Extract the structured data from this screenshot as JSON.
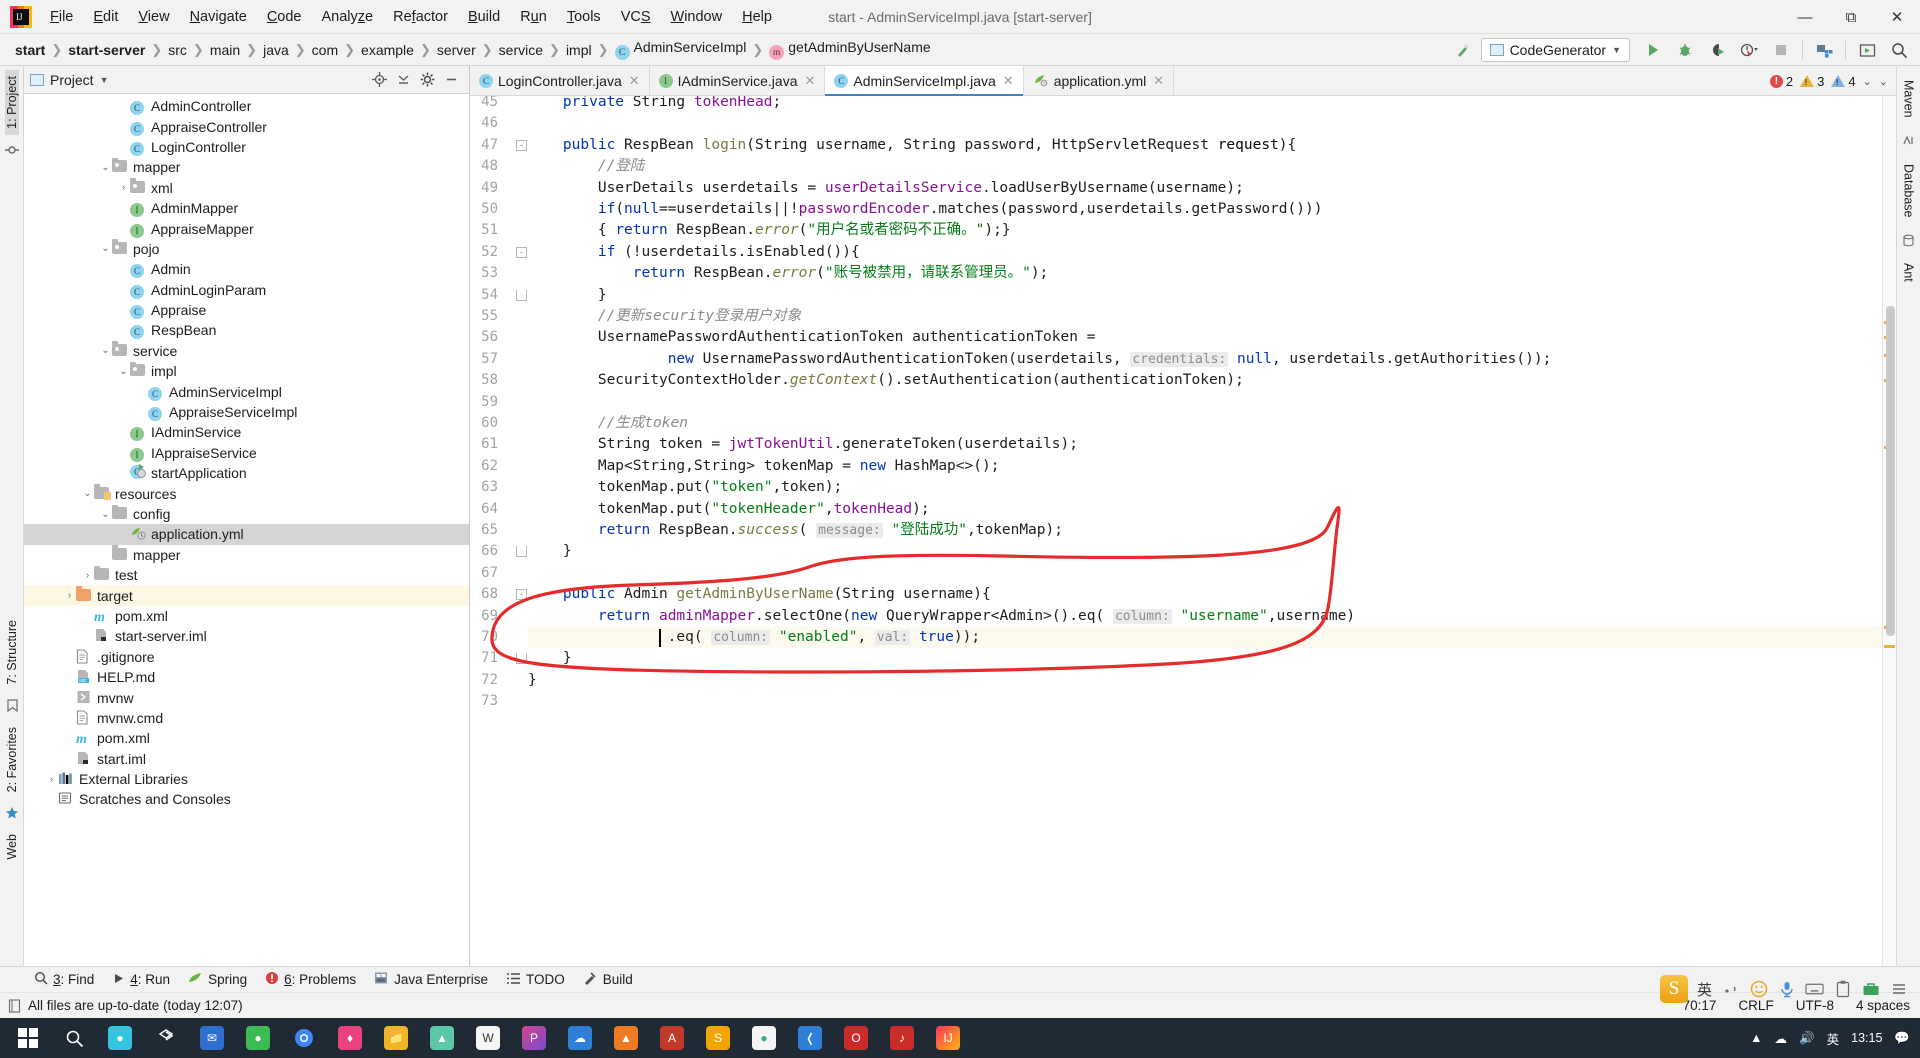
{
  "window": {
    "title": "start - AdminServiceImpl.java [start-server]",
    "menu": [
      "File",
      "Edit",
      "View",
      "Navigate",
      "Code",
      "Analyze",
      "Refactor",
      "Build",
      "Run",
      "Tools",
      "VCS",
      "Window",
      "Help"
    ],
    "controls": {
      "minimize": "—",
      "maximize": "❐",
      "close": "✕"
    }
  },
  "breadcrumbs": [
    {
      "label": "start",
      "bold": true,
      "icon": null
    },
    {
      "label": "start-server",
      "bold": true,
      "icon": null
    },
    {
      "label": "src",
      "bold": false,
      "icon": null
    },
    {
      "label": "main",
      "bold": false,
      "icon": null
    },
    {
      "label": "java",
      "bold": false,
      "icon": null
    },
    {
      "label": "com",
      "bold": false,
      "icon": null
    },
    {
      "label": "example",
      "bold": false,
      "icon": null
    },
    {
      "label": "server",
      "bold": false,
      "icon": null
    },
    {
      "label": "service",
      "bold": false,
      "icon": null
    },
    {
      "label": "impl",
      "bold": false,
      "icon": null
    },
    {
      "label": "AdminServiceImpl",
      "bold": false,
      "icon": "class"
    },
    {
      "label": "getAdminByUserName",
      "bold": false,
      "icon": "method"
    }
  ],
  "toolbar": {
    "run_config": "CodeGenerator",
    "run_config_caret": "▼",
    "icons": [
      "build-hammer-icon",
      "run-icon",
      "debug-icon",
      "run-coverage-icon",
      "profiler-icon",
      "stop-icon",
      "project-structure-icon",
      "select-in-icon",
      "search-everywhere-icon"
    ]
  },
  "project_panel": {
    "title": "Project",
    "title_caret": "▼",
    "header_icons": [
      "locate-icon",
      "collapse-all-icon",
      "settings-gear-icon",
      "hide-icon"
    ],
    "tree": [
      {
        "depth": 5,
        "label": "AdminController",
        "icon": "class",
        "arrow": "",
        "state": "normal"
      },
      {
        "depth": 5,
        "label": "AppraiseController",
        "icon": "class",
        "arrow": "",
        "state": "normal"
      },
      {
        "depth": 5,
        "label": "LoginController",
        "icon": "class",
        "arrow": "",
        "state": "normal"
      },
      {
        "depth": 4,
        "label": "mapper",
        "icon": "package",
        "arrow": "⌄",
        "state": "normal"
      },
      {
        "depth": 5,
        "label": "xml",
        "icon": "package",
        "arrow": "›",
        "state": "normal"
      },
      {
        "depth": 5,
        "label": "AdminMapper",
        "icon": "interface",
        "arrow": "",
        "state": "normal"
      },
      {
        "depth": 5,
        "label": "AppraiseMapper",
        "icon": "interface",
        "arrow": "",
        "state": "normal"
      },
      {
        "depth": 4,
        "label": "pojo",
        "icon": "package",
        "arrow": "⌄",
        "state": "normal"
      },
      {
        "depth": 5,
        "label": "Admin",
        "icon": "class",
        "arrow": "",
        "state": "normal"
      },
      {
        "depth": 5,
        "label": "AdminLoginParam",
        "icon": "class",
        "arrow": "",
        "state": "normal"
      },
      {
        "depth": 5,
        "label": "Appraise",
        "icon": "class",
        "arrow": "",
        "state": "normal"
      },
      {
        "depth": 5,
        "label": "RespBean",
        "icon": "class",
        "arrow": "",
        "state": "normal"
      },
      {
        "depth": 4,
        "label": "service",
        "icon": "package",
        "arrow": "⌄",
        "state": "normal"
      },
      {
        "depth": 5,
        "label": "impl",
        "icon": "package",
        "arrow": "⌄",
        "state": "normal"
      },
      {
        "depth": 6,
        "label": "AdminServiceImpl",
        "icon": "class",
        "arrow": "",
        "state": "normal"
      },
      {
        "depth": 6,
        "label": "AppraiseServiceImpl",
        "icon": "class",
        "arrow": "",
        "state": "normal"
      },
      {
        "depth": 5,
        "label": "IAdminService",
        "icon": "interface",
        "arrow": "",
        "state": "normal"
      },
      {
        "depth": 5,
        "label": "IAppraiseService",
        "icon": "interface",
        "arrow": "",
        "state": "normal"
      },
      {
        "depth": 5,
        "label": "startApplication",
        "icon": "spring-class",
        "arrow": "",
        "state": "normal"
      },
      {
        "depth": 3,
        "label": "resources",
        "icon": "resources-folder",
        "arrow": "⌄",
        "state": "normal"
      },
      {
        "depth": 4,
        "label": "config",
        "icon": "folder",
        "arrow": "⌄",
        "state": "normal"
      },
      {
        "depth": 5,
        "label": "application.yml",
        "icon": "yml-spring",
        "arrow": "",
        "state": "selected"
      },
      {
        "depth": 4,
        "label": "mapper",
        "icon": "folder",
        "arrow": "",
        "state": "normal"
      },
      {
        "depth": 3,
        "label": "test",
        "icon": "folder",
        "arrow": "›",
        "state": "normal"
      },
      {
        "depth": 2,
        "label": "target",
        "icon": "folder-orange",
        "arrow": "›",
        "state": "highlight"
      },
      {
        "depth": 3,
        "label": "pom.xml",
        "icon": "maven",
        "arrow": "",
        "state": "normal"
      },
      {
        "depth": 3,
        "label": "start-server.iml",
        "icon": "iml",
        "arrow": "",
        "state": "normal"
      },
      {
        "depth": 2,
        "label": ".gitignore",
        "icon": "file",
        "arrow": "",
        "state": "normal"
      },
      {
        "depth": 2,
        "label": "HELP.md",
        "icon": "md",
        "arrow": "",
        "state": "normal"
      },
      {
        "depth": 2,
        "label": "mvnw",
        "icon": "script",
        "arrow": "",
        "state": "normal"
      },
      {
        "depth": 2,
        "label": "mvnw.cmd",
        "icon": "file",
        "arrow": "",
        "state": "normal"
      },
      {
        "depth": 2,
        "label": "pom.xml",
        "icon": "maven",
        "arrow": "",
        "state": "normal"
      },
      {
        "depth": 2,
        "label": "start.iml",
        "icon": "iml",
        "arrow": "",
        "state": "normal"
      },
      {
        "depth": 1,
        "label": "External Libraries",
        "icon": "libraries",
        "arrow": "›",
        "state": "normal"
      },
      {
        "depth": 1,
        "label": "Scratches and Consoles",
        "icon": "scratches",
        "arrow": "",
        "state": "normal"
      }
    ]
  },
  "left_rail": {
    "top": "1: Project",
    "middle": [
      "7: Structure",
      "2: Favorites"
    ],
    "bottom": "Web"
  },
  "right_rail": {
    "items": [
      "Maven",
      "Database",
      "Ant"
    ]
  },
  "tabs": [
    {
      "label": "LoginController.java",
      "icon": "class",
      "active": false,
      "close": "✕"
    },
    {
      "label": "IAdminService.java",
      "icon": "interface",
      "active": false,
      "close": "✕"
    },
    {
      "label": "AdminServiceImpl.java",
      "icon": "class",
      "active": true,
      "close": "✕"
    },
    {
      "label": "application.yml",
      "icon": "yml",
      "active": false,
      "close": "✕"
    }
  ],
  "inspection_status": {
    "errors": "2",
    "warnings": "3",
    "weak_warnings": "4",
    "collapse": "⌄",
    "chevron": "⌄"
  },
  "editor": {
    "first_line": 45,
    "current_line": 70,
    "lines": [
      {
        "n": 45,
        "partial": true,
        "segments": [
          {
            "t": "    private String ",
            "c": "kw2-mixed"
          }
        ]
      },
      {
        "n": 46,
        "segments": []
      },
      {
        "n": 47,
        "fold": "minus",
        "segments": []
      },
      {
        "n": 48,
        "segments": []
      },
      {
        "n": 49,
        "segments": []
      },
      {
        "n": 50,
        "segments": []
      },
      {
        "n": 51,
        "segments": []
      },
      {
        "n": 52,
        "fold": "minus",
        "segments": []
      },
      {
        "n": 53,
        "segments": []
      },
      {
        "n": 54,
        "fold": "end",
        "segments": []
      },
      {
        "n": 55,
        "segments": []
      },
      {
        "n": 56,
        "segments": []
      },
      {
        "n": 57,
        "segments": []
      },
      {
        "n": 58,
        "segments": []
      },
      {
        "n": 59,
        "segments": []
      },
      {
        "n": 60,
        "segments": []
      },
      {
        "n": 61,
        "segments": []
      },
      {
        "n": 62,
        "segments": []
      },
      {
        "n": 63,
        "segments": []
      },
      {
        "n": 64,
        "segments": []
      },
      {
        "n": 65,
        "segments": []
      },
      {
        "n": 66,
        "fold": "end",
        "segments": []
      },
      {
        "n": 67,
        "segments": []
      },
      {
        "n": 68,
        "fold": "minus",
        "segments": []
      },
      {
        "n": 69,
        "segments": []
      },
      {
        "n": 70,
        "segments": []
      },
      {
        "n": 71,
        "segments": []
      },
      {
        "n": 72,
        "segments": []
      },
      {
        "n": 73,
        "segments": []
      }
    ],
    "code_text": {
      "l45": "private String tokenHead;",
      "l47": "public RespBean login(String username, String password, HttpServletRequest request){",
      "l48": "//登陆",
      "l49": "UserDetails userdetails = userDetailsService.loadUserByUsername(username);",
      "l50": "if(null==userdetails||!passwordEncoder.matches(password,userdetails.getPassword()))",
      "l51": "{ return RespBean.error(\"用户名或者密码不正确。\");}",
      "l52": "if (!userdetails.isEnabled()){",
      "l53": "return RespBean.error(\"账号被禁用，请联系管理员。\");",
      "l54": "}",
      "l55": "//更新security登录用户对象",
      "l56": "UsernamePasswordAuthenticationToken authenticationToken =",
      "l57": "new UsernamePasswordAuthenticationToken(userdetails, credentials: null, userdetails.getAuthorities());",
      "l58": "SecurityContextHolder.getContext().setAuthentication(authenticationToken);",
      "l60": "//生成token",
      "l61": "String token = jwtTokenUtil.generateToken(userdetails);",
      "l62": "Map<String,String> tokenMap = new HashMap<>();",
      "l63": "tokenMap.put(\"token\",token);",
      "l64": "tokenMap.put(\"tokenHeader\",tokenHead);",
      "l65": "return RespBean.success( message: \"登陆成功\",tokenMap);",
      "l66": "}",
      "l68": "public Admin getAdminByUserName(String username){",
      "l69": "return adminMapper.selectOne(new QueryWrapper<Admin>().eq( column: \"username\",username)",
      "l70": ".eq( column: \"enabled\", val: true));",
      "l71": "}",
      "l72": "}"
    },
    "inlay_hints": {
      "credentials": "credentials:",
      "message": "message:",
      "column": "column:",
      "val": "val:"
    }
  },
  "bottom_tools": [
    {
      "num": "3",
      "label": "Find",
      "icon": "search-icon"
    },
    {
      "num": "4",
      "label": "Run",
      "icon": "run-icon"
    },
    {
      "num": "",
      "label": "Spring",
      "icon": "spring-leaf-icon"
    },
    {
      "num": "6",
      "label": "Problems",
      "icon": "error-icon"
    },
    {
      "num": "",
      "label": "Java Enterprise",
      "icon": "java-enterprise-icon"
    },
    {
      "num": "",
      "label": "TODO",
      "icon": "todo-icon"
    },
    {
      "num": "",
      "label": "Build",
      "icon": "build-hammer-icon"
    }
  ],
  "status_bar": {
    "message": "All files are up-to-date (today 12:07)",
    "caret_position": "70:17",
    "line_separator": "CRLF",
    "encoding": "UTF-8",
    "indent": "4 spaces"
  },
  "ime_bar": {
    "logo": "S",
    "mode": "英",
    "items": [
      "sogou-logo",
      "lang-en",
      "comma-dot",
      "smiley-icon",
      "mic-icon",
      "keyboard-icon",
      "clipboard-icon",
      "toolbox-icon",
      "menu-icon"
    ]
  },
  "taskbar": {
    "time": "13:15",
    "tray": [
      "show-desktop",
      "network-icon",
      "volume-icon",
      "ime-icon",
      "notification-icon"
    ]
  },
  "colors": {
    "accent": "#3c86c7",
    "keyword": "#0033b3",
    "string": "#067d17",
    "field": "#871094",
    "comment": "#8c8c8c",
    "annotation_red": "#e52b2b",
    "selection": "#d4d4d4",
    "highlight_row": "#fdf8e3",
    "current_line": "#fcfaef"
  }
}
